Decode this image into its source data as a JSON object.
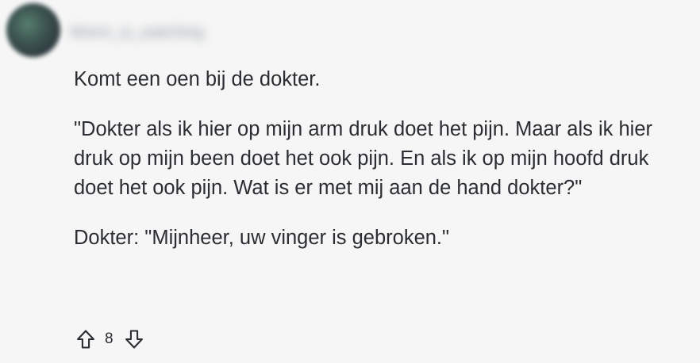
{
  "comment": {
    "author": "Worm_is_watching",
    "paragraphs": [
      "Komt een oen bij de dokter.",
      "\"Dokter als ik hier op mijn arm druk doet het pijn. Maar als ik hier druk op mijn been doet het ook pijn. En als ik op mijn hoofd druk doet het ook pijn. Wat is er met mij aan de hand dokter?\"",
      "Dokter: \"Mijnheer, uw vinger is gebroken.\""
    ],
    "score": "8",
    "upvote_icon": "arrow-up-outline",
    "downvote_icon": "arrow-down-outline"
  }
}
